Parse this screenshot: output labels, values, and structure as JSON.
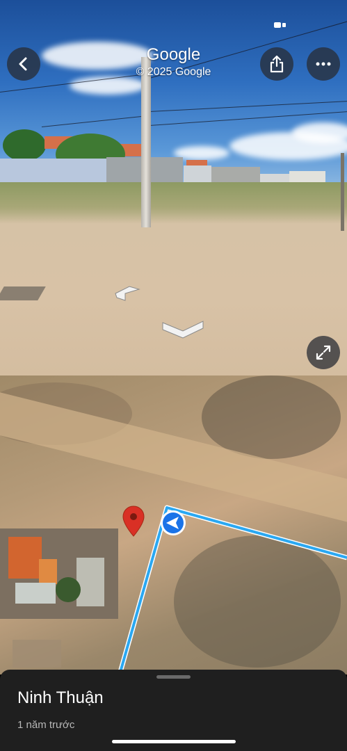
{
  "streetview": {
    "brand": "Google",
    "copyright": "© 2025 Google",
    "back_icon": "chevron-left-icon",
    "share_icon": "share-icon",
    "more_icon": "more-horizontal-icon",
    "expand_icon": "expand-icon"
  },
  "map": {
    "pin_color": "#d93025",
    "route_color": "#2aa8f2",
    "location_arrow_color": "#1a73e8"
  },
  "place": {
    "name": "Ninh Thuận",
    "time": "1 năm trước"
  }
}
